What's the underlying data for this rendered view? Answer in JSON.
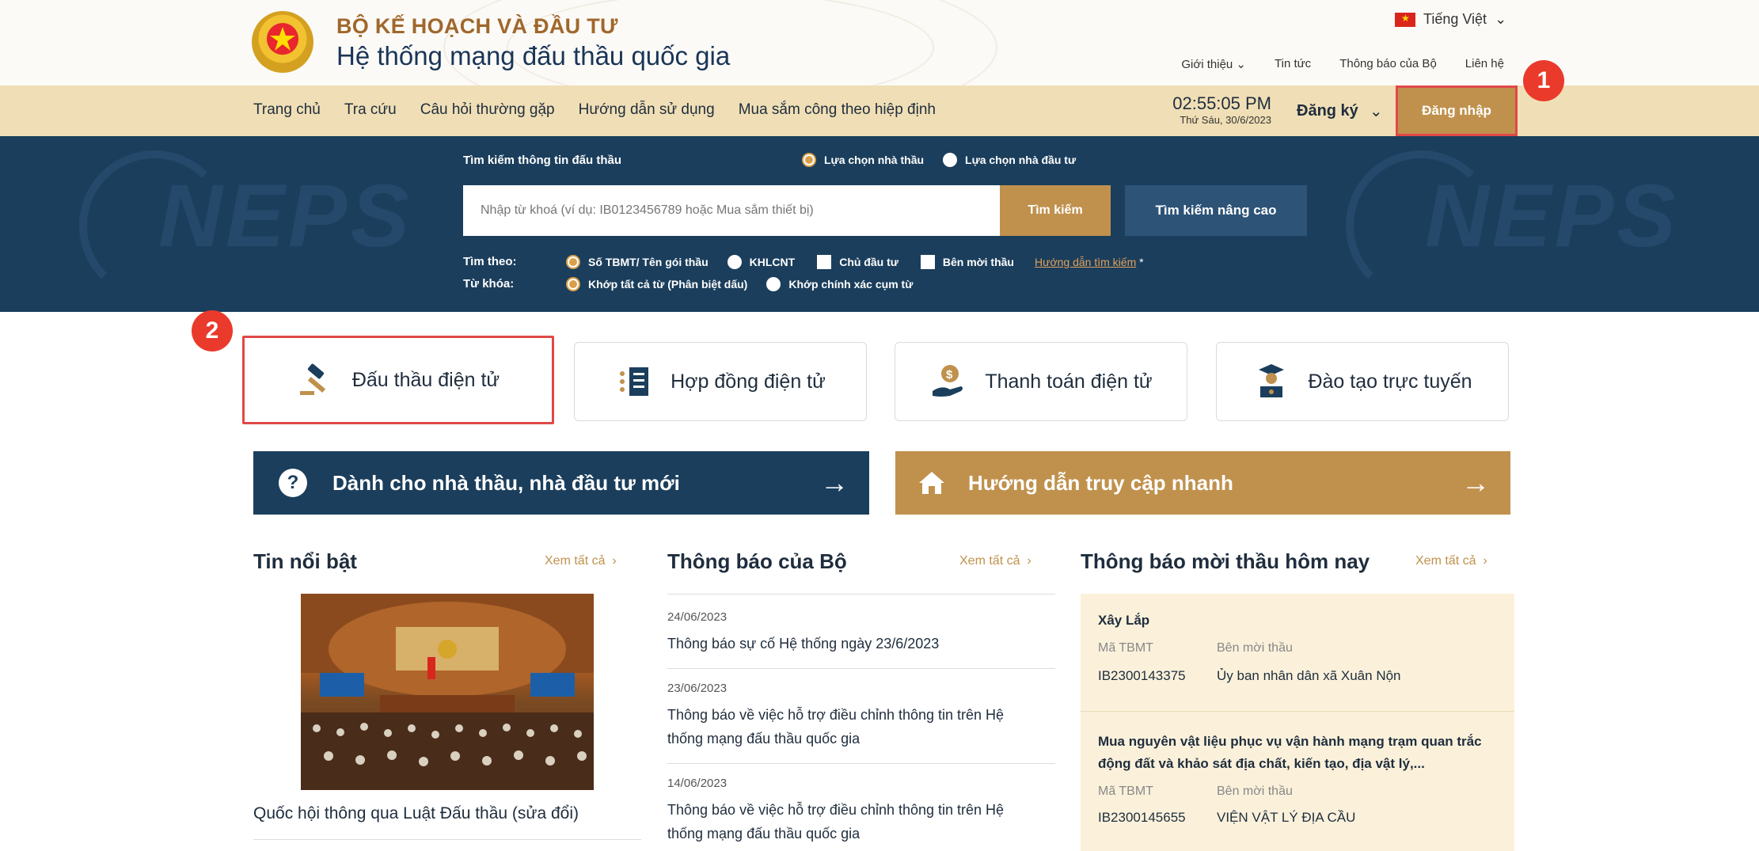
{
  "header": {
    "org": "BỘ KẾ HOẠCH VÀ ĐẦU TƯ",
    "system": "Hệ thống mạng đấu thầu quốc gia",
    "language": "Tiếng Việt",
    "top_links": [
      "Giới thiệu",
      "Tin tức",
      "Thông báo của Bộ",
      "Liên hệ"
    ]
  },
  "nav": {
    "items": [
      "Trang chủ",
      "Tra cứu",
      "Câu hỏi thường gặp",
      "Hướng dẫn sử dụng",
      "Mua sắm công theo hiệp định"
    ],
    "time": "02:55:05 PM",
    "date": "Thứ Sáu, 30/6/2023",
    "register": "Đăng ký",
    "login": "Đăng nhập"
  },
  "annotations": {
    "badge1": "1",
    "badge2": "2"
  },
  "search": {
    "title": "Tìm kiếm thông tin đấu thầu",
    "mode_options": [
      "Lựa chọn nhà thầu",
      "Lựa chọn nhà đầu tư"
    ],
    "placeholder": "Nhập từ khoá (ví dụ: IB0123456789 hoặc Mua sắm thiết bị)",
    "button": "Tìm kiếm",
    "advanced": "Tìm kiếm nâng cao",
    "by_label": "Tìm theo:",
    "by_options": [
      "Số TBMT/ Tên gói thầu",
      "KHLCNT",
      "Chủ đầu tư",
      "Bên mời thầu"
    ],
    "guide": "Hướng dẫn tìm kiếm",
    "guide_mark": "*",
    "keyword_label": "Từ khóa:",
    "keyword_options": [
      "Khớp tất cả từ (Phân biệt dấu)",
      "Khớp chính xác cụm từ"
    ],
    "watermark": "NEPS"
  },
  "services": [
    "Đấu thầu điện tử",
    "Hợp đồng điện tử",
    "Thanh toán điện tử",
    "Đào tạo trực tuyến"
  ],
  "banners": {
    "new": "Dành cho nhà thầu, nhà đầu tư mới",
    "quick": "Hướng dẫn truy cập nhanh",
    "arrow": "→"
  },
  "columns": {
    "featured": {
      "title": "Tin nổi bật",
      "see_all": "Xem tất cả",
      "caption": "Quốc hội thông qua Luật Đấu thầu (sửa đổi)"
    },
    "ministry": {
      "title": "Thông báo của Bộ",
      "see_all": "Xem tất cả",
      "items": [
        {
          "date": "24/06/2023",
          "title": "Thông báo sự cố Hệ thống ngày 23/6/2023"
        },
        {
          "date": "23/06/2023",
          "title": "Thông báo về việc hỗ trợ điều chỉnh thông tin trên Hệ thống mạng đấu thầu quốc gia"
        },
        {
          "date": "14/06/2023",
          "title": "Thông báo về việc hỗ trợ điều chỉnh thông tin trên Hệ thống mạng đấu thầu quốc gia"
        }
      ]
    },
    "tenders": {
      "title": "Thông báo mời thầu hôm nay",
      "see_all": "Xem tất cả",
      "col_code": "Mã TBMT",
      "col_party": "Bên mời thầu",
      "items": [
        {
          "category": "Xây Lắp",
          "code": "IB2300143375",
          "party": "Ủy ban nhân dân xã Xuân Nộn"
        },
        {
          "category": "Mua nguyên vật liệu phục vụ vận hành mạng trạm quan trắc động đất và khảo sát địa chất, kiến tạo, địa vật lý,...",
          "code": "IB2300145655",
          "party": "VIỆN VẬT LÝ ĐỊA CẦU"
        }
      ]
    }
  },
  "colors": {
    "navy": "#1b3e5c",
    "gold": "#c0914d",
    "nav_bg": "#f0dfb6",
    "highlight": "#e04848"
  }
}
